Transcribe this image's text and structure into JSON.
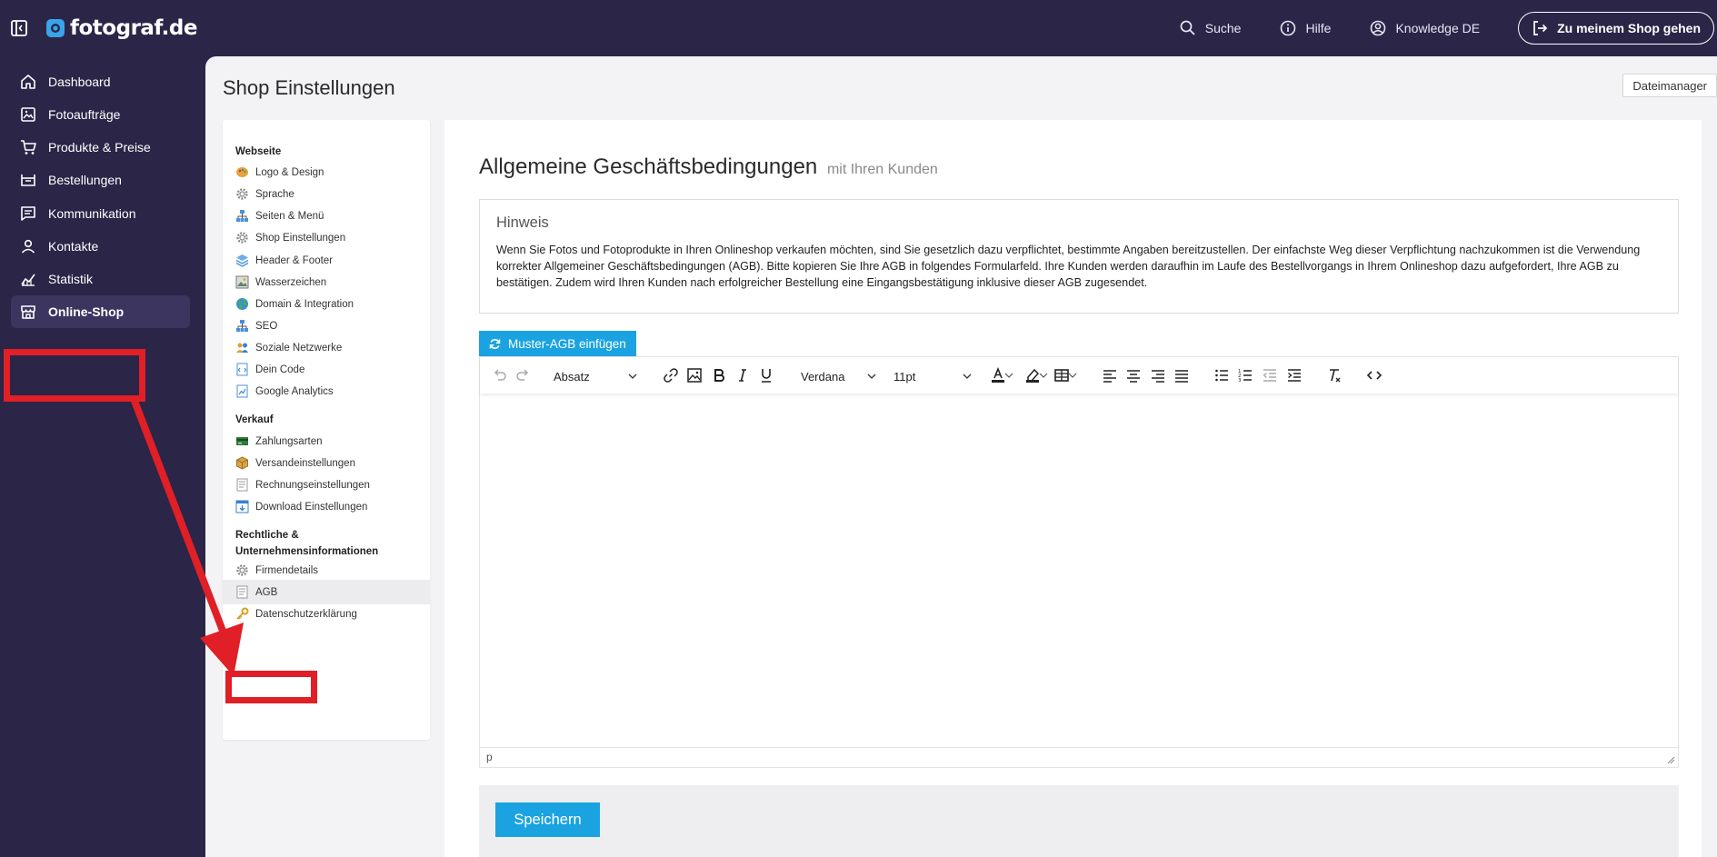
{
  "app": {
    "logo_text": "fotograf.de",
    "brand_color": "#2b2548",
    "accent_color": "#1aa3e0"
  },
  "topbar": {
    "search": "Suche",
    "help": "Hilfe",
    "account": "Knowledge DE",
    "shop_button": "Zu meinem Shop gehen"
  },
  "sidebar": {
    "items": [
      {
        "label": "Dashboard",
        "icon": "home-icon"
      },
      {
        "label": "Fotoaufträge",
        "icon": "image-icon"
      },
      {
        "label": "Produkte & Preise",
        "icon": "cart-icon"
      },
      {
        "label": "Bestellungen",
        "icon": "basket-icon"
      },
      {
        "label": "Kommunikation",
        "icon": "message-icon"
      },
      {
        "label": "Kontakte",
        "icon": "user-icon"
      },
      {
        "label": "Statistik",
        "icon": "chart-icon"
      },
      {
        "label": "Online-Shop",
        "icon": "store-icon",
        "active": true
      }
    ]
  },
  "page": {
    "title": "Shop Einstellungen",
    "file_manager": "Dateimanager"
  },
  "settings_menu": {
    "sections": [
      {
        "title": "Webseite",
        "items": [
          "Logo & Design",
          "Sprache",
          "Seiten & Menü",
          "Shop Einstellungen",
          "Header & Footer",
          "Wasserzeichen",
          "Domain & Integration",
          "SEO",
          "Soziale Netzwerke",
          "Dein Code",
          "Google Analytics"
        ]
      },
      {
        "title": "Verkauf",
        "items": [
          "Zahlungsarten",
          "Versandeinstellungen",
          "Rechnungseinstellungen",
          "Download Einstellungen"
        ]
      },
      {
        "title_line1": "Rechtliche &",
        "title_line2": "Unternehmensinformationen",
        "items": [
          "Firmendetails",
          "AGB",
          "Datenschutzerklärung"
        ]
      }
    ],
    "active_item": "AGB"
  },
  "content": {
    "title": "Allgemeine Geschäftsbedingungen",
    "subtitle": "mit Ihren Kunden",
    "hint_title": "Hinweis",
    "hint_text": "Wenn Sie Fotos und Fotoprodukte in Ihren Onlineshop verkaufen möchten, sind Sie gesetzlich dazu verpflichtet, bestimmte Angaben bereitzustellen. Der einfachste Weg dieser Verpflichtung nachzukommen ist die Verwendung korrekter Allgemeiner Geschäftsbedingungen (AGB). Bitte kopieren Sie Ihre AGB in folgendes Formularfeld. Ihre Kunden werden daraufhin im Laufe des Bestellvorgangs in Ihrem Onlineshop dazu aufgefordert, Ihre AGB zu bestätigen. Zudem wird Ihren Kunden nach erfolgreicher Bestellung eine Eingangsbestätigung inklusive dieser AGB zugesendet.",
    "insert_button": "Muster-AGB einfügen",
    "editor": {
      "block_format": "Absatz",
      "font_family": "Verdana",
      "font_size": "11pt",
      "status_path": "p"
    },
    "save_button": "Speichern"
  },
  "annotation": {
    "color": "#e01f26"
  }
}
